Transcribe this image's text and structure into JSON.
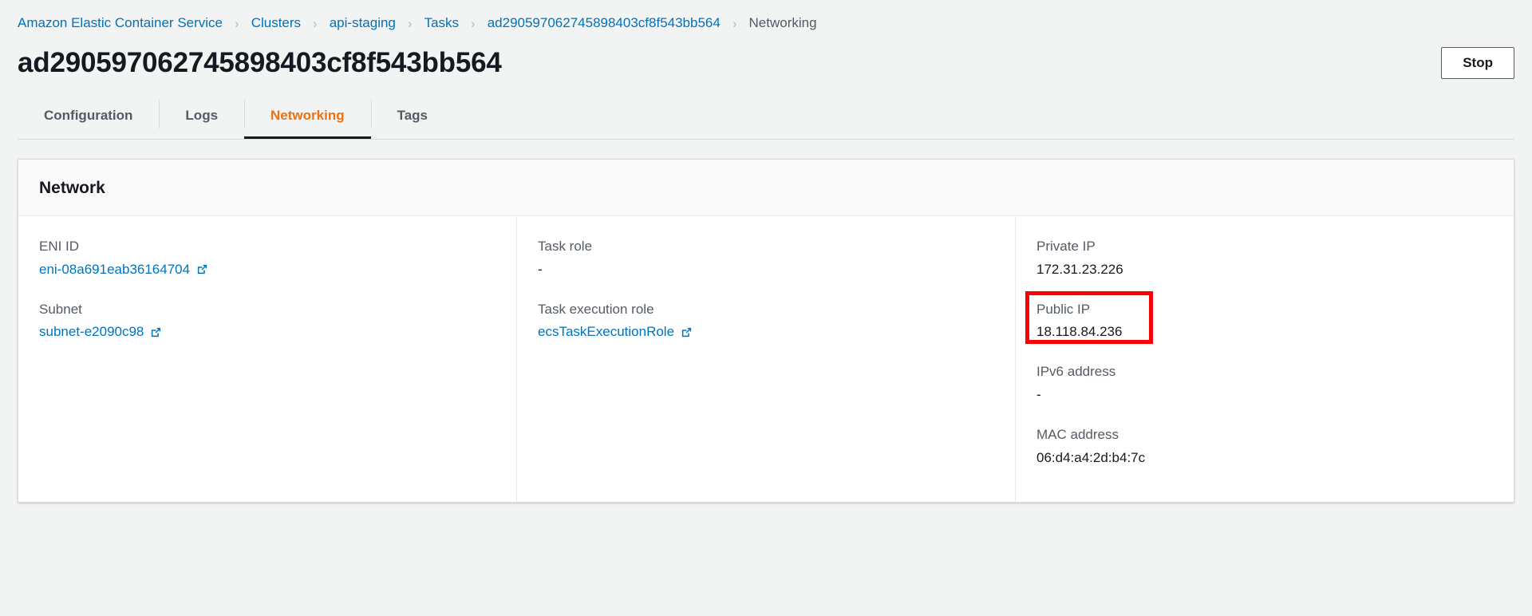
{
  "breadcrumb": {
    "separator": "›",
    "items": [
      {
        "label": "Amazon Elastic Container Service",
        "current": false
      },
      {
        "label": "Clusters",
        "current": false
      },
      {
        "label": "api-staging",
        "current": false
      },
      {
        "label": "Tasks",
        "current": false
      },
      {
        "label": "ad290597062745898403cf8f543bb564",
        "current": false
      },
      {
        "label": "Networking",
        "current": true
      }
    ]
  },
  "header": {
    "title": "ad290597062745898403cf8f543bb564",
    "stop_label": "Stop"
  },
  "tabs": [
    {
      "label": "Configuration",
      "active": false
    },
    {
      "label": "Logs",
      "active": false
    },
    {
      "label": "Networking",
      "active": true
    },
    {
      "label": "Tags",
      "active": false
    }
  ],
  "network_card": {
    "title": "Network",
    "columns": [
      {
        "fields": [
          {
            "label": "ENI ID",
            "value": "eni-08a691eab36164704",
            "link": true,
            "external": true,
            "highlighted": false
          },
          {
            "label": "Subnet",
            "value": "subnet-e2090c98",
            "link": true,
            "external": true,
            "highlighted": false
          }
        ]
      },
      {
        "fields": [
          {
            "label": "Task role",
            "value": "-",
            "link": false,
            "external": false,
            "highlighted": false
          },
          {
            "label": "Task execution role",
            "value": "ecsTaskExecutionRole",
            "link": true,
            "external": true,
            "highlighted": false
          }
        ]
      },
      {
        "fields": [
          {
            "label": "Private IP",
            "value": "172.31.23.226",
            "link": false,
            "external": false,
            "highlighted": false
          },
          {
            "label": "Public IP",
            "value": "18.118.84.236",
            "link": false,
            "external": false,
            "highlighted": true
          },
          {
            "label": "IPv6 address",
            "value": "-",
            "link": false,
            "external": false,
            "highlighted": false
          },
          {
            "label": "MAC address",
            "value": "06:d4:a4:2d:b4:7c",
            "link": false,
            "external": false,
            "highlighted": false
          }
        ]
      }
    ]
  },
  "colors": {
    "link": "#0073bb",
    "accent": "#ec7211",
    "highlight": "#ff0000",
    "page_bg": "#f2f3f3",
    "text": "#16191f",
    "muted": "#545b64"
  }
}
